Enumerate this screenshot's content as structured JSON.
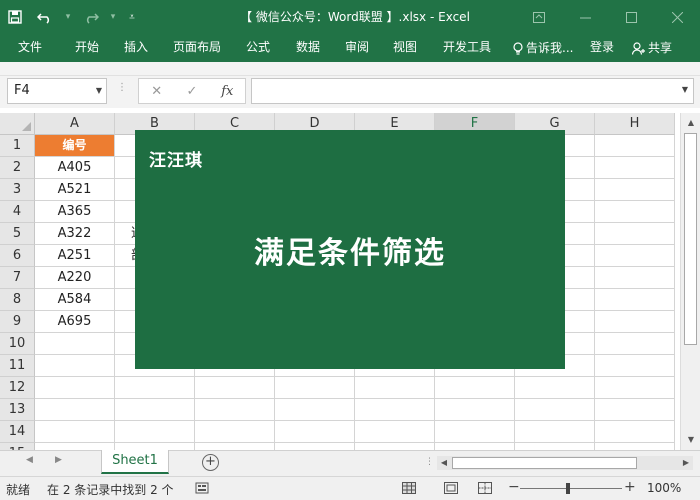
{
  "app": {
    "title": "【 微信公众号：Word联盟 】.xlsx  -  Excel"
  },
  "qat": {
    "save_icon": "save-icon",
    "undo_icon": "undo-icon",
    "redo_icon": "redo-icon",
    "customize_icon": "customize-qat-icon"
  },
  "window_controls": {
    "ribbon_options_icon": "ribbon-display-options-icon",
    "minimize_icon": "minimize-icon",
    "maximize_icon": "maximize-icon",
    "close_icon": "close-icon"
  },
  "ribbon": {
    "tabs": [
      "文件",
      "开始",
      "插入",
      "页面布局",
      "公式",
      "数据",
      "审阅",
      "视图",
      "开发工具"
    ],
    "tell_me": "告诉我...",
    "login": "登录",
    "share": "共享"
  },
  "formula_bar": {
    "name_box": "F4",
    "cancel_symbol": "✕",
    "enter_symbol": "✓",
    "fx_label": "fx",
    "formula_value": ""
  },
  "grid": {
    "columns": [
      "A",
      "B",
      "C",
      "D",
      "E",
      "F",
      "G",
      "H"
    ],
    "selected_column": "F",
    "row_numbers": [
      "1",
      "2",
      "3",
      "4",
      "5",
      "6",
      "7",
      "8",
      "9",
      "10",
      "11",
      "12",
      "13",
      "14",
      "15"
    ],
    "col_a": [
      "编号",
      "A405",
      "A521",
      "A365",
      "A322",
      "A251",
      "A220",
      "A584",
      "A695"
    ],
    "col_b_visible": {
      "row5": "道",
      "row6": "部"
    },
    "header_fill_color": "#ed7d31"
  },
  "overlay": {
    "author": "汪汪琪",
    "title": "满足条件筛选",
    "background_color": "#1e6e42"
  },
  "sheets": {
    "active": "Sheet1",
    "add_icon": "add-sheet-icon"
  },
  "status": {
    "ready": "就绪",
    "message": "在 2 条记录中找到 2 个",
    "zoom": "100%"
  },
  "colors": {
    "excel_green": "#217346"
  }
}
